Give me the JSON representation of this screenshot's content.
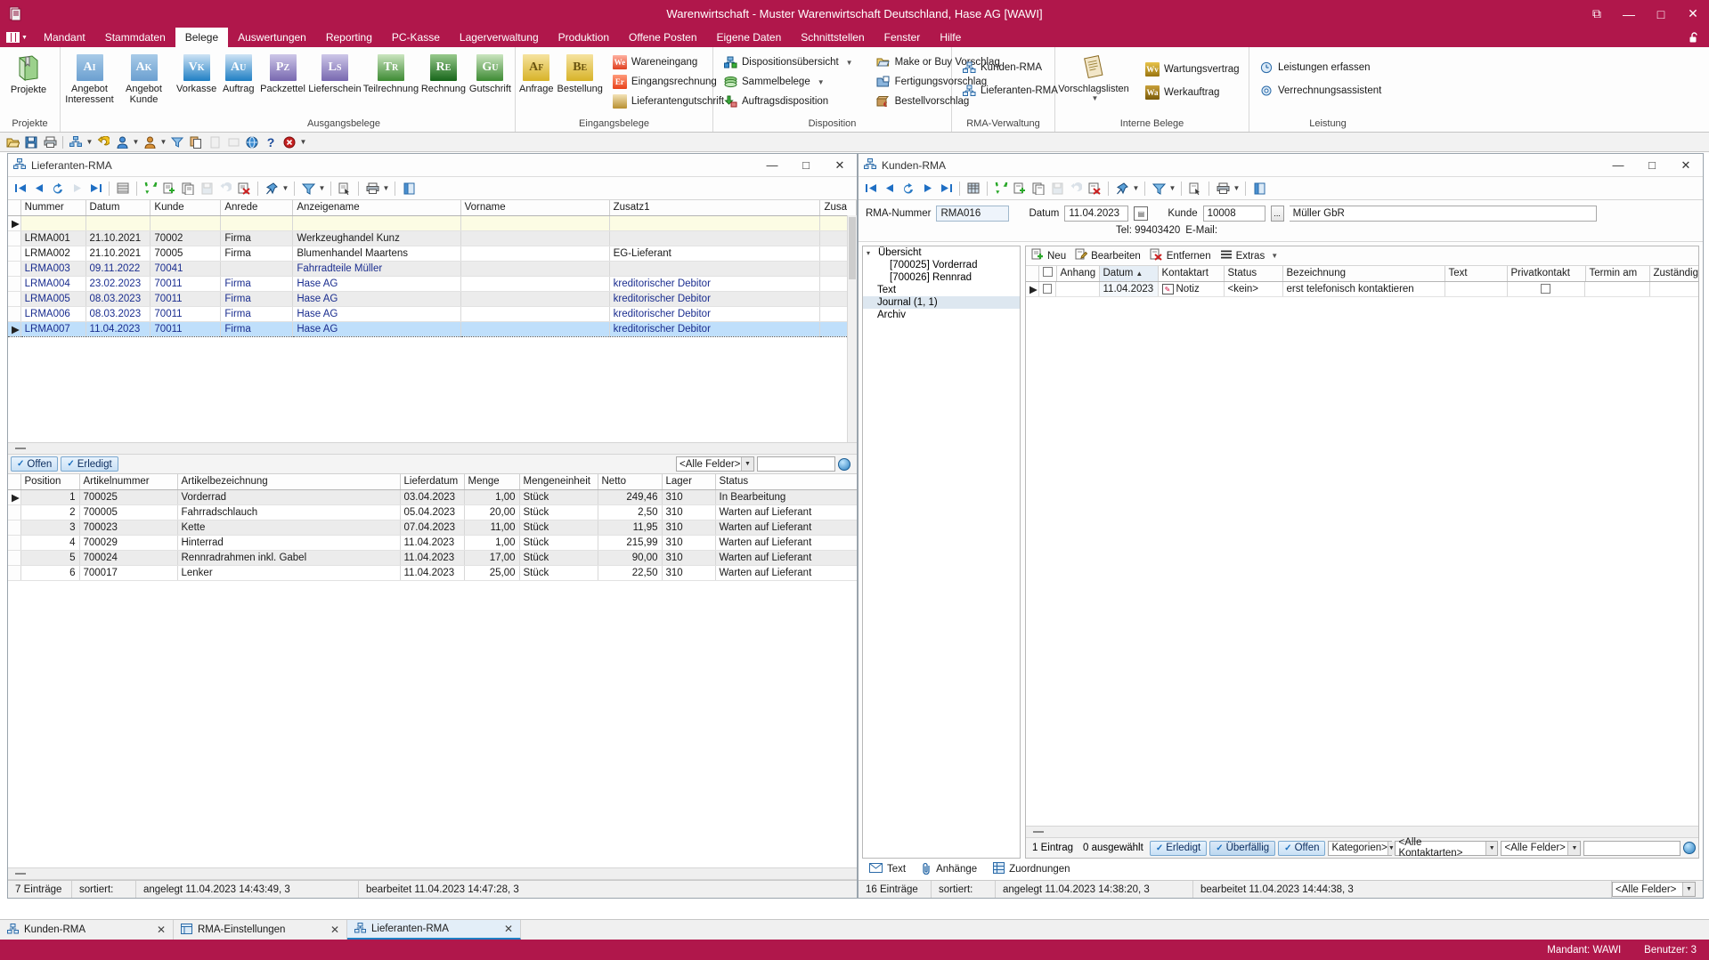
{
  "window": {
    "title": "Warenwirtschaft - Muster Warenwirtschaft Deutschland, Hase AG [WAWI]",
    "minimize": "—",
    "maximize": "□",
    "close": "✕",
    "restore_icon": "⧉",
    "app_icon": "☷",
    "lock_icon": "🔓"
  },
  "menu": {
    "items": [
      "Mandant",
      "Stammdaten",
      "Belege",
      "Auswertungen",
      "Reporting",
      "PC-Kasse",
      "Lagerverwaltung",
      "Produktion",
      "Offene Posten",
      "Eigene Daten",
      "Schnittstellen",
      "Fenster",
      "Hilfe"
    ],
    "active": "Belege"
  },
  "ribbon": {
    "groups": [
      {
        "label": "Projekte",
        "big_buttons": [
          {
            "label": "Projekte",
            "glyph": "📗",
            "style": "book"
          }
        ]
      },
      {
        "label": "",
        "big_buttons": [
          {
            "label": "Angebot\nInteressent",
            "abbr": "Ai",
            "style": "t-blue2"
          },
          {
            "label": "Angebot\nKunde",
            "abbr": "Ak",
            "style": "t-blue2"
          }
        ]
      },
      {
        "label": "Ausgangsbelege",
        "big_buttons": [
          {
            "label": "Vorkasse",
            "abbr": "Vk",
            "style": "t-blue"
          },
          {
            "label": "Auftrag",
            "abbr": "Au",
            "style": "t-blue"
          },
          {
            "label": "Packzettel",
            "abbr": "Pz",
            "style": "t-purple"
          },
          {
            "label": "Lieferschein",
            "abbr": "Ls",
            "style": "t-purple"
          },
          {
            "label": "Teilrechnung",
            "abbr": "Tr",
            "style": "t-green"
          },
          {
            "label": "Rechnung",
            "abbr": "Re",
            "style": "t-dgreen"
          },
          {
            "label": "Gutschrift",
            "abbr": "Gu",
            "style": "t-green"
          }
        ]
      },
      {
        "label": "Eingangsbelege",
        "big_buttons": [
          {
            "label": "Anfrage",
            "abbr": "Af",
            "style": "t-gold"
          },
          {
            "label": "Bestellung",
            "abbr": "Be",
            "style": "t-gold"
          }
        ],
        "small_buttons": [
          {
            "label": "Wareneingang",
            "abbr": "We",
            "style": "si-red"
          },
          {
            "label": "Eingangsrechnung",
            "abbr": "Er",
            "style": "si-orange"
          },
          {
            "label": "Lieferantengutschrift",
            "abbr": "",
            "style": "si-tan"
          }
        ]
      },
      {
        "label": "Disposition",
        "small_buttons": [
          {
            "label": "Dispositionsübersicht",
            "icon": "network-icon",
            "dropdown": true
          },
          {
            "label": "Sammelbelege",
            "icon": "stack-icon",
            "dropdown": true
          },
          {
            "label": "Auftragsdisposition",
            "icon": "download-icon",
            "dropdown": false
          }
        ],
        "small_buttons2": [
          {
            "label": "Make or Buy Vorschlag",
            "icon": "folder-icon"
          },
          {
            "label": "Fertigungsvorschlag",
            "icon": "folder-blue-icon"
          },
          {
            "label": "Bestellvorschlag",
            "icon": "box-euro-icon"
          }
        ]
      },
      {
        "label": "RMA-Verwaltung",
        "small_buttons": [
          {
            "label": "Kunden-RMA",
            "icon": "rma-icon"
          },
          {
            "label": "Lieferanten-RMA",
            "icon": "rma-icon"
          }
        ]
      },
      {
        "label": "Interne Belege",
        "big_buttons": [
          {
            "label": "Vorschlagslisten",
            "glyph": "📄",
            "style": "paper",
            "dropdown": true
          }
        ],
        "small_buttons": [
          {
            "label": "Wartungsvertrag",
            "abbr": "Wv",
            "style": "si-gold2"
          },
          {
            "label": "Werkauftrag",
            "abbr": "Wa",
            "style": "si-dgold"
          }
        ]
      },
      {
        "label": "Leistung",
        "small_buttons": [
          {
            "label": "Leistungen erfassen",
            "icon": "clock-icon"
          },
          {
            "label": "Verrechnungsassistent",
            "icon": "gear-icon"
          }
        ]
      }
    ]
  },
  "quick_toolbar": {
    "icons": [
      "folder-open-icon",
      "save-icon",
      "print-icon",
      "network-icon",
      "undo-icon",
      "person-icon",
      "persons-icon",
      "copy-icon",
      "doc1-icon",
      "doc2-icon",
      "globe-icon",
      "help-icon",
      "close-red-icon",
      "overflow-icon"
    ]
  },
  "lieferanten_rma": {
    "title": "Lieferanten-RMA",
    "nav_icons": [
      "first",
      "prev",
      "refresh-row",
      "next",
      "last",
      "list",
      "refresh",
      "new",
      "copy",
      "save",
      "undo",
      "delete",
      "pin",
      "filter",
      "select",
      "print",
      "export"
    ],
    "columns": [
      "Nummer",
      "Datum",
      "Kunde",
      "Anrede",
      "Anzeigename",
      "Vorname",
      "Zusatz1",
      "Zusa"
    ],
    "rows": [
      {
        "nummer": "LRMA001",
        "datum": "21.10.2021",
        "kunde": "70002",
        "anrede": "Firma",
        "anzeigename": "Werkzeughandel Kunz",
        "vorname": "",
        "zusatz1": "",
        "alt": true,
        "blue": false,
        "sel": false
      },
      {
        "nummer": "LRMA002",
        "datum": "21.10.2021",
        "kunde": "70005",
        "anrede": "Firma",
        "anzeigename": "Blumenhandel  Maartens",
        "vorname": "",
        "zusatz1": "EG-Lieferant",
        "alt": false,
        "blue": false,
        "sel": false
      },
      {
        "nummer": "LRMA003",
        "datum": "09.11.2022",
        "kunde": "70041",
        "anrede": "",
        "anzeigename": "Fahrradteile Müller",
        "vorname": "",
        "zusatz1": "",
        "alt": true,
        "blue": true,
        "sel": false
      },
      {
        "nummer": "LRMA004",
        "datum": "23.02.2023",
        "kunde": "70011",
        "anrede": "Firma",
        "anzeigename": "Hase AG",
        "vorname": "",
        "zusatz1": "kreditorischer Debitor",
        "alt": false,
        "blue": true,
        "sel": false
      },
      {
        "nummer": "LRMA005",
        "datum": "08.03.2023",
        "kunde": "70011",
        "anrede": "Firma",
        "anzeigename": "Hase AG",
        "vorname": "",
        "zusatz1": "kreditorischer Debitor",
        "alt": true,
        "blue": true,
        "sel": false
      },
      {
        "nummer": "LRMA006",
        "datum": "08.03.2023",
        "kunde": "70011",
        "anrede": "Firma",
        "anzeigename": "Hase AG",
        "vorname": "",
        "zusatz1": "kreditorischer Debitor",
        "alt": false,
        "blue": true,
        "sel": false
      },
      {
        "nummer": "LRMA007",
        "datum": "11.04.2023",
        "kunde": "70011",
        "anrede": "Firma",
        "anzeigename": "Hase AG",
        "vorname": "",
        "zusatz1": "kreditorischer Debitor",
        "alt": false,
        "blue": true,
        "sel": true
      }
    ],
    "filter_bar": {
      "offen": "Offen",
      "erledigt": "Erledigt",
      "field_select": "<Alle Felder>",
      "search_value": ""
    },
    "positions": {
      "columns": [
        "Position",
        "Artikelnummer",
        "Artikelbezeichnung",
        "Lieferdatum",
        "Menge",
        "Mengeneinheit",
        "Netto",
        "Lager",
        "Status"
      ],
      "rows": [
        {
          "position": "1",
          "artikelnummer": "700025",
          "artikelbezeichnung": "Vorderrad",
          "lieferdatum": "03.04.2023",
          "menge": "1,00",
          "mengeneinheit": "Stück",
          "netto": "249,46",
          "lager": "310",
          "status": "In Bearbeitung",
          "alt": true
        },
        {
          "position": "2",
          "artikelnummer": "700005",
          "artikelbezeichnung": "Fahrradschlauch",
          "lieferdatum": "05.04.2023",
          "menge": "20,00",
          "mengeneinheit": "Stück",
          "netto": "2,50",
          "lager": "310",
          "status": "Warten auf Lieferant",
          "alt": false
        },
        {
          "position": "3",
          "artikelnummer": "700023",
          "artikelbezeichnung": "Kette",
          "lieferdatum": "07.04.2023",
          "menge": "11,00",
          "mengeneinheit": "Stück",
          "netto": "11,95",
          "lager": "310",
          "status": "Warten auf Lieferant",
          "alt": true
        },
        {
          "position": "4",
          "artikelnummer": "700029",
          "artikelbezeichnung": "Hinterrad",
          "lieferdatum": "11.04.2023",
          "menge": "1,00",
          "mengeneinheit": "Stück",
          "netto": "215,99",
          "lager": "310",
          "status": "Warten auf Lieferant",
          "alt": false
        },
        {
          "position": "5",
          "artikelnummer": "700024",
          "artikelbezeichnung": "Rennradrahmen inkl. Gabel",
          "lieferdatum": "11.04.2023",
          "menge": "17,00",
          "mengeneinheit": "Stück",
          "netto": "90,00",
          "lager": "310",
          "status": "Warten auf Lieferant",
          "alt": true
        },
        {
          "position": "6",
          "artikelnummer": "700017",
          "artikelbezeichnung": "Lenker",
          "lieferdatum": "11.04.2023",
          "menge": "25,00",
          "mengeneinheit": "Stück",
          "netto": "22,50",
          "lager": "310",
          "status": "Warten auf Lieferant",
          "alt": false
        }
      ]
    },
    "status": {
      "count": "7 Einträge",
      "sorted_label": "sortiert:",
      "created": "angelegt 11.04.2023 14:43:49,  3",
      "edited": "bearbeitet 11.04.2023 14:47:28,  3"
    }
  },
  "kunden_rma": {
    "title": "Kunden-RMA",
    "fields": {
      "rma_nummer_label": "RMA-Nummer",
      "rma_nummer_value": "RMA016",
      "datum_label": "Datum",
      "datum_value": "11.04.2023",
      "kunde_label": "Kunde",
      "kunde_value": "10008",
      "kunde_name": "Müller GbR",
      "tel_label": "Tel: 99403420",
      "email_label": "E-Mail:"
    },
    "tree": [
      {
        "label": "Übersicht",
        "level": 0,
        "chevron": "⌄",
        "sel": false
      },
      {
        "label": "[700025] Vorderrad",
        "level": 1,
        "chevron": "",
        "sel": false
      },
      {
        "label": "[700026] Rennrad",
        "level": 1,
        "chevron": "",
        "sel": false
      },
      {
        "label": "Text",
        "level": 0,
        "chevron": "",
        "sel": false
      },
      {
        "label": "Journal (1, 1)",
        "level": 0,
        "chevron": "",
        "sel": true
      },
      {
        "label": "Archiv",
        "level": 0,
        "chevron": "",
        "sel": false
      }
    ],
    "actions": [
      {
        "label": "Neu",
        "icon": "new-icon"
      },
      {
        "label": "Bearbeiten",
        "icon": "edit-icon"
      },
      {
        "label": "Entfernen",
        "icon": "remove-icon"
      },
      {
        "label": "Extras",
        "icon": "menu-icon",
        "dropdown": true
      }
    ],
    "journal": {
      "columns": [
        "Anhang",
        "Datum",
        "Kontaktart",
        "Status",
        "Bezeichnung",
        "Text",
        "Privatkontakt",
        "Termin am",
        "Zuständig"
      ],
      "sort_column": "Datum",
      "rows": [
        {
          "anhang": "",
          "datum": "11.04.2023",
          "kontaktart": "Notiz",
          "status": "<kein>",
          "bezeichnung": "erst telefonisch kontaktieren",
          "text": "",
          "privatkontakt": "",
          "termin_am": "",
          "zustaendig": ""
        }
      ]
    },
    "filter_bar": {
      "count": "1 Eintrag",
      "selected": "0 ausgewählt",
      "erledigt": "Erledigt",
      "ueberfaellig": "Überfällig",
      "offen": "Offen",
      "kategorien": "Kategorien>",
      "kontaktarten": "<Alle Kontaktarten>",
      "felder": "<Alle Felder>",
      "search_value": ""
    },
    "bottom_links": [
      {
        "label": "Text",
        "icon": "envelope-icon"
      },
      {
        "label": "Anhänge",
        "icon": "clip-icon"
      },
      {
        "label": "Zuordnungen",
        "icon": "grid-icon"
      }
    ],
    "status": {
      "count": "16 Einträge",
      "sorted_label": "sortiert:",
      "created": "angelegt 11.04.2023 14:38:20,  3",
      "edited": "bearbeitet 11.04.2023 14:44:38,  3",
      "felder": "<Alle Felder>"
    }
  },
  "taskbar": {
    "items": [
      {
        "label": "Kunden-RMA",
        "active": false
      },
      {
        "label": "RMA-Einstellungen",
        "active": false
      },
      {
        "label": "Lieferanten-RMA",
        "active": true
      }
    ],
    "close_glyph": "✕"
  },
  "bottombar": {
    "mandant": "Mandant: WAWI",
    "benutzer": "Benutzer: 3"
  }
}
